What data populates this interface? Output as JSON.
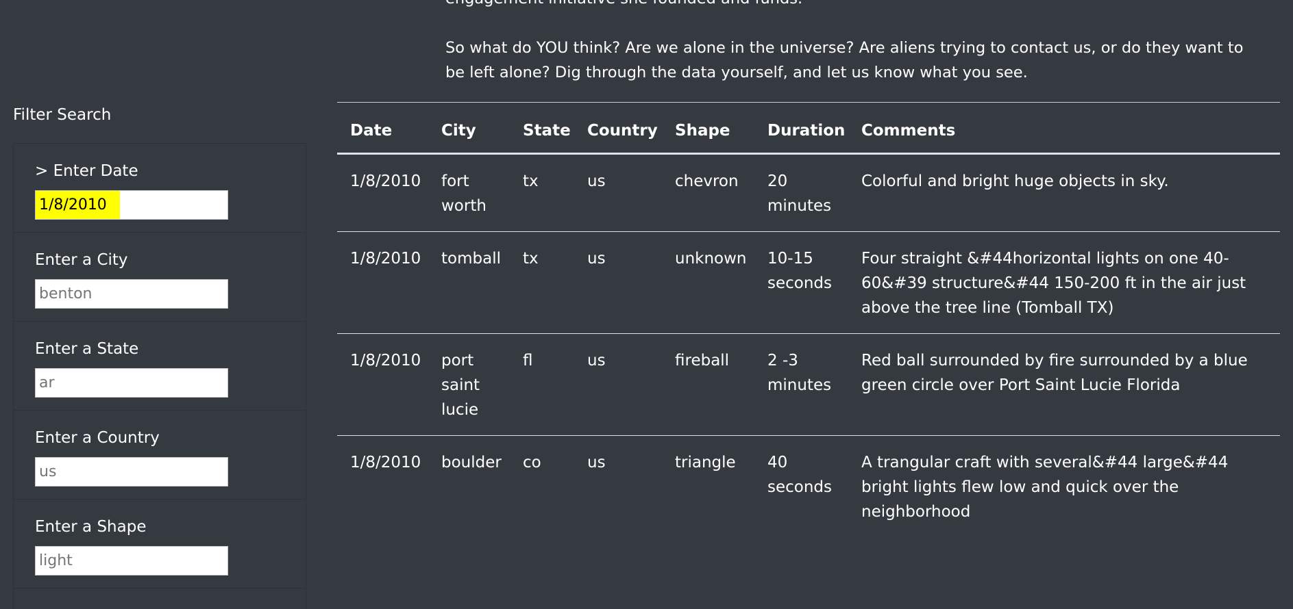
{
  "intro": {
    "partial_line": "engagement initiative she founded and funds.",
    "paragraph": "So what do YOU think? Are we alone in the universe? Are aliens trying to contact us, or do they want to be left alone? Dig through the data yourself, and let us know what you see."
  },
  "sidebar": {
    "title": "Filter Search",
    "filters": [
      {
        "label": "> Enter Date",
        "value": "1/8/2010",
        "placeholder": ""
      },
      {
        "label": "Enter a City",
        "value": "",
        "placeholder": "benton"
      },
      {
        "label": "Enter a State",
        "value": "",
        "placeholder": "ar"
      },
      {
        "label": "Enter a Country",
        "value": "",
        "placeholder": "us"
      },
      {
        "label": "Enter a Shape",
        "value": "",
        "placeholder": "light"
      }
    ]
  },
  "table": {
    "headers": [
      "Date",
      "City",
      "State",
      "Country",
      "Shape",
      "Duration",
      "Comments"
    ],
    "rows": [
      [
        "1/8/2010",
        "fort worth",
        "tx",
        "us",
        "chevron",
        "20 minutes",
        "Colorful and bright huge objects in sky."
      ],
      [
        "1/8/2010",
        "tomball",
        "tx",
        "us",
        "unknown",
        "10-15 seconds",
        "Four straight &#44horizontal lights on one 40-60&#39 structure&#44 150-200 ft in the air just above the tree line (Tomball TX)"
      ],
      [
        "1/8/2010",
        "port saint lucie",
        "fl",
        "us",
        "fireball",
        "2 -3 minutes",
        "Red ball surrounded by fire surrounded by a blue green circle over Port Saint Lucie Florida"
      ],
      [
        "1/8/2010",
        "boulder",
        "co",
        "us",
        "triangle",
        "40 seconds",
        "A trangular craft with several&#44 large&#44 bright lights flew low and quick over the neighborhood"
      ]
    ]
  },
  "colors": {
    "background": "#343a40",
    "highlight": "#ffff00"
  }
}
